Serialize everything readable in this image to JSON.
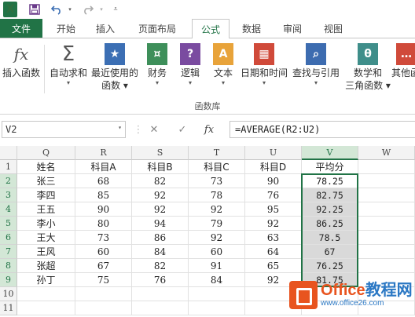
{
  "qat": {
    "save_icon": "save-icon",
    "undo_icon": "undo-icon",
    "redo_icon": "redo-icon",
    "customize_icon": "customize-icon"
  },
  "tabs": {
    "file": "文件",
    "items": [
      "开始",
      "插入",
      "页面布局",
      "公式",
      "数据",
      "审阅",
      "视图"
    ],
    "active": "公式"
  },
  "ribbon": {
    "buttons": [
      {
        "label": "插入函数",
        "icon": "fx-icon"
      },
      {
        "label": "自动求和",
        "icon": "sigma-icon",
        "caret": "▾"
      },
      {
        "label": "最近使用的",
        "label2": "函数 ▾",
        "icon": "star-book-icon"
      },
      {
        "label": "财务",
        "icon": "coins-book-icon",
        "caret": "▾"
      },
      {
        "label": "逻辑",
        "icon": "question-book-icon",
        "caret": "▾"
      },
      {
        "label": "文本",
        "icon": "text-book-icon",
        "caret": "▾"
      },
      {
        "label": "日期和时间",
        "icon": "calendar-book-icon",
        "caret": "▾"
      },
      {
        "label": "查找与引用",
        "icon": "search-book-icon",
        "caret": "▾"
      },
      {
        "label": "数学和",
        "label2": "三角函数 ▾",
        "icon": "theta-book-icon"
      },
      {
        "label": "其他函",
        "icon": "more-book-icon",
        "caret": "▾"
      }
    ],
    "group_label": "函数库",
    "colors": {
      "blue": "#3c6fb4",
      "green": "#3e8f5a",
      "purple": "#7a4ba0",
      "orange": "#e8a33a",
      "red": "#d04a3a",
      "teal": "#3f8e8a",
      "navy": "#3d6cb0"
    }
  },
  "formula_bar": {
    "name_box": "V2",
    "fx_label": "fx",
    "formula": "=AVERAGE(R2:U2)"
  },
  "sheet": {
    "columns": [
      "Q",
      "R",
      "S",
      "T",
      "U",
      "V",
      "W"
    ],
    "selected_column": "V",
    "row_numbers": [
      "1",
      "2",
      "3",
      "4",
      "5",
      "6",
      "7",
      "8",
      "9",
      "10",
      "11"
    ],
    "header_row": [
      "姓名",
      "科目A",
      "科目B",
      "科目C",
      "科目D",
      "平均分"
    ],
    "rows": [
      [
        "张三",
        "68",
        "82",
        "73",
        "90",
        "78.25"
      ],
      [
        "李四",
        "85",
        "92",
        "78",
        "76",
        "82.75"
      ],
      [
        "王五",
        "90",
        "92",
        "92",
        "95",
        "92.25"
      ],
      [
        "李小",
        "80",
        "94",
        "79",
        "92",
        "86.25"
      ],
      [
        "王大",
        "73",
        "86",
        "92",
        "63",
        "78.5"
      ],
      [
        "王风",
        "60",
        "84",
        "60",
        "64",
        "67"
      ],
      [
        "张超",
        "67",
        "82",
        "91",
        "65",
        "76.25"
      ],
      [
        "孙丁",
        "75",
        "76",
        "84",
        "92",
        "81.75"
      ]
    ],
    "accent": "#217346"
  },
  "watermark": {
    "title_a": "Office",
    "title_b": "教程网",
    "url": "www.office26.com"
  }
}
